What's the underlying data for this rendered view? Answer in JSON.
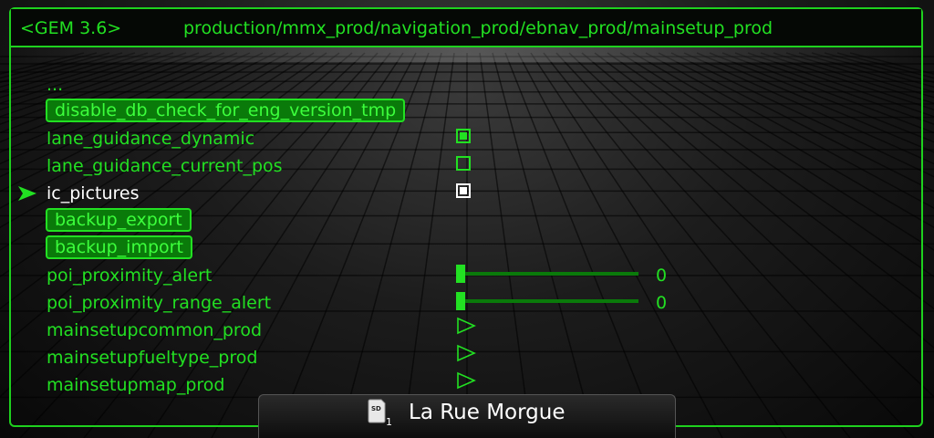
{
  "header": {
    "version": "<GEM 3.6>",
    "path": "production/mmx_prod/navigation_prod/ebnav_prod/mainsetup_prod"
  },
  "menu": {
    "up_label": "...",
    "items": [
      {
        "label": "disable_db_check_for_eng_version_tmp",
        "type": "button"
      },
      {
        "label": "lane_guidance_dynamic",
        "type": "checkbox",
        "checked": true
      },
      {
        "label": "lane_guidance_current_pos",
        "type": "checkbox",
        "checked": false
      },
      {
        "label": "ic_pictures",
        "type": "checkbox",
        "checked": true,
        "selected": true
      },
      {
        "label": "backup_export",
        "type": "button"
      },
      {
        "label": "backup_import",
        "type": "button"
      },
      {
        "label": "poi_proximity_alert",
        "type": "slider",
        "value": "0"
      },
      {
        "label": "poi_proximity_range_alert",
        "type": "slider",
        "value": "0"
      },
      {
        "label": "mainsetupcommon_prod",
        "type": "submenu"
      },
      {
        "label": "mainsetupfueltype_prod",
        "type": "submenu"
      },
      {
        "label": "mainsetupmap_prod",
        "type": "submenu"
      }
    ]
  },
  "media": {
    "source_icon": "sd-card-1-icon",
    "title": "La Rue Morgue"
  },
  "colors": {
    "accent": "#22e022",
    "selected": "#ffffff",
    "button_fill": "#0a7a0a"
  }
}
